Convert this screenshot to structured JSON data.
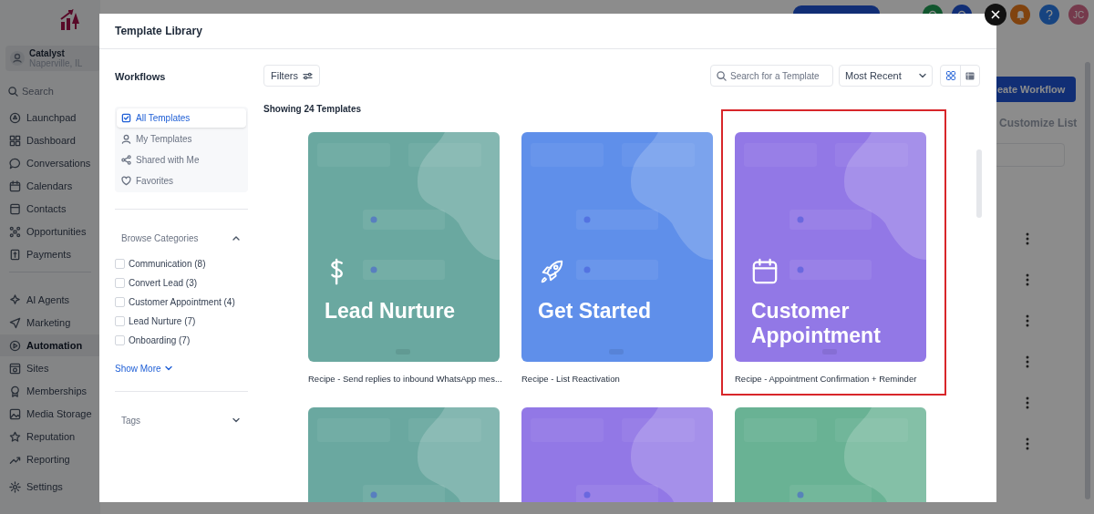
{
  "app": {
    "account": {
      "name": "Catalyst",
      "location": "Naperville, IL"
    },
    "search": {
      "placeholder": "Search"
    },
    "nav": [
      {
        "label": "Launchpad",
        "selected": false
      },
      {
        "label": "Dashboard",
        "selected": false
      },
      {
        "label": "Conversations",
        "selected": false
      },
      {
        "label": "Calendars",
        "selected": false
      },
      {
        "label": "Contacts",
        "selected": false
      },
      {
        "label": "Opportunities",
        "selected": false
      },
      {
        "label": "Payments",
        "selected": false
      },
      {
        "label": "AI Agents",
        "selected": false
      },
      {
        "label": "Marketing",
        "selected": false
      },
      {
        "label": "Automation",
        "selected": true
      },
      {
        "label": "Sites",
        "selected": false
      },
      {
        "label": "Memberships",
        "selected": false
      },
      {
        "label": "Media Storage",
        "selected": false
      },
      {
        "label": "Reputation",
        "selected": false
      },
      {
        "label": "Reporting",
        "selected": false
      },
      {
        "label": "Settings",
        "selected": false
      }
    ],
    "avatar": "JC",
    "create_button": "eate Workflow",
    "customize": "Customize List"
  },
  "modal": {
    "title": "Template Library",
    "sidebar": {
      "heading": "Workflows",
      "views": [
        {
          "label": "All Templates",
          "selected": true
        },
        {
          "label": "My Templates",
          "selected": false
        },
        {
          "label": "Shared with Me",
          "selected": false
        },
        {
          "label": "Favorites",
          "selected": false
        }
      ],
      "categories": {
        "heading": "Browse Categories",
        "expanded": true,
        "items": [
          {
            "label": "Communication (8)",
            "checked": false
          },
          {
            "label": "Convert Lead (3)",
            "checked": false
          },
          {
            "label": "Customer Appointment (4)",
            "checked": false
          },
          {
            "label": "Lead Nurture (7)",
            "checked": false
          },
          {
            "label": "Onboarding (7)",
            "checked": false
          }
        ],
        "show_more": "Show More"
      },
      "tags": {
        "heading": "Tags",
        "expanded": false
      }
    },
    "filters": "Filters",
    "search": {
      "placeholder": "Search for a Template"
    },
    "sort": "Most Recent",
    "view_toggle": [
      {
        "selected": true
      },
      {
        "selected": false
      }
    ],
    "count": "Showing 24 Templates",
    "templates": [
      {
        "kind": "dollar",
        "title": "Lead Nurture",
        "caption": "Recipe - Send replies to inbound WhatsApp mes...",
        "color": "#6aa8a0",
        "highlighted": false
      },
      {
        "kind": "rocket",
        "title": "Get Started",
        "caption": "Recipe - List Reactivation",
        "color": "#5f8fea",
        "highlighted": false
      },
      {
        "kind": "calendar",
        "title": "Customer Appointment",
        "caption": "Recipe - Appointment Confirmation + Reminder",
        "color": "#9278e6",
        "highlighted": true
      },
      {
        "kind": "plain",
        "color": "#6aa8a0",
        "highlighted": false
      },
      {
        "kind": "plain",
        "color": "#9278e6",
        "highlighted": false
      },
      {
        "kind": "plain",
        "color": "#69b294",
        "highlighted": false
      }
    ]
  }
}
